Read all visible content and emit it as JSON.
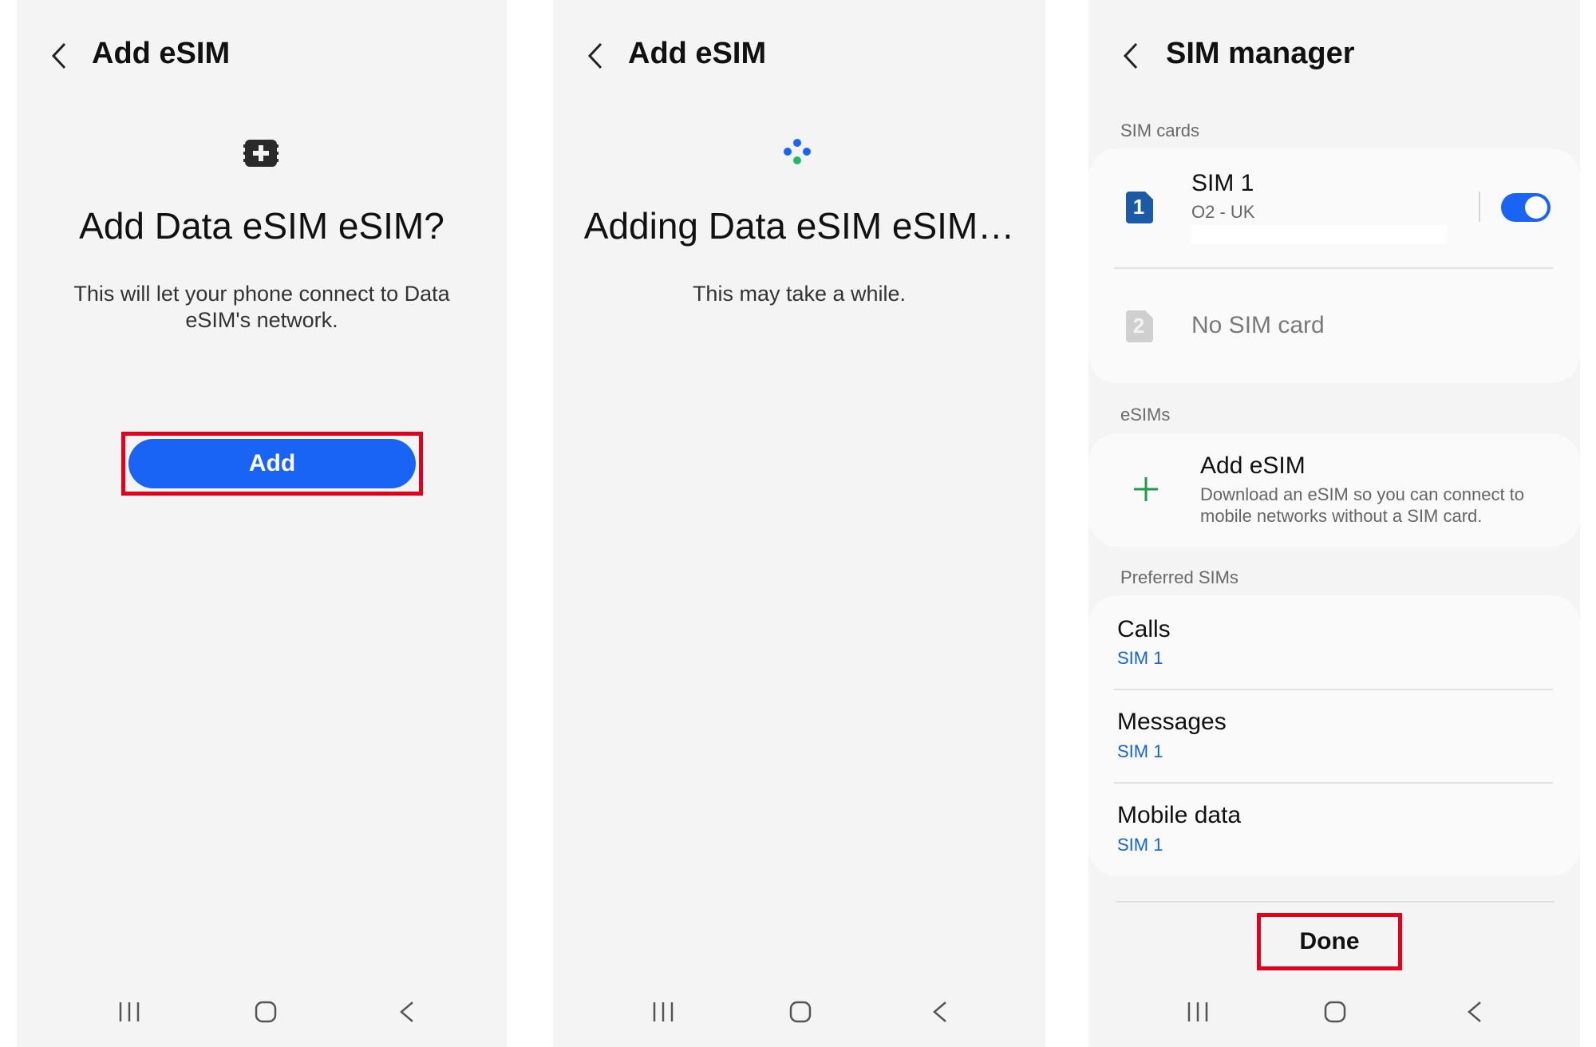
{
  "panel1": {
    "title": "Add eSIM",
    "heading": "Add Data eSIM eSIM?",
    "description": "This will let your phone connect to Data eSIM's network.",
    "add_button": "Add"
  },
  "panel2": {
    "title": "Add eSIM",
    "heading": "Adding Data eSIM eSIM…",
    "description": "This may take a while."
  },
  "panel3": {
    "title": "SIM manager",
    "sim_cards_label": "SIM cards",
    "sim1": {
      "badge": "1",
      "name": "SIM 1",
      "carrier": "O2 - UK",
      "enabled": true
    },
    "sim2": {
      "badge": "2",
      "name": "No SIM card"
    },
    "esims_label": "eSIMs",
    "add_esim": {
      "title": "Add eSIM",
      "description": "Download an eSIM so you can connect to mobile networks without a SIM card."
    },
    "preferred_label": "Preferred SIMs",
    "preferred": [
      {
        "title": "Calls",
        "value": "SIM 1"
      },
      {
        "title": "Messages",
        "value": "SIM 1"
      },
      {
        "title": "Mobile data",
        "value": "SIM 1"
      }
    ],
    "done_button": "Done"
  },
  "colors": {
    "accent": "#1a64f5",
    "highlight": "#e4001b",
    "toggle_on": "#1a64f5",
    "add_icon": "#1e9b4a"
  },
  "icons": {
    "back": "chevron-left-icon",
    "sim_add": "sim-card-add-icon",
    "loading": "loading-dots-icon",
    "plus": "plus-icon",
    "recents": "recents-icon",
    "home": "home-icon",
    "nav_back": "nav-back-icon"
  }
}
